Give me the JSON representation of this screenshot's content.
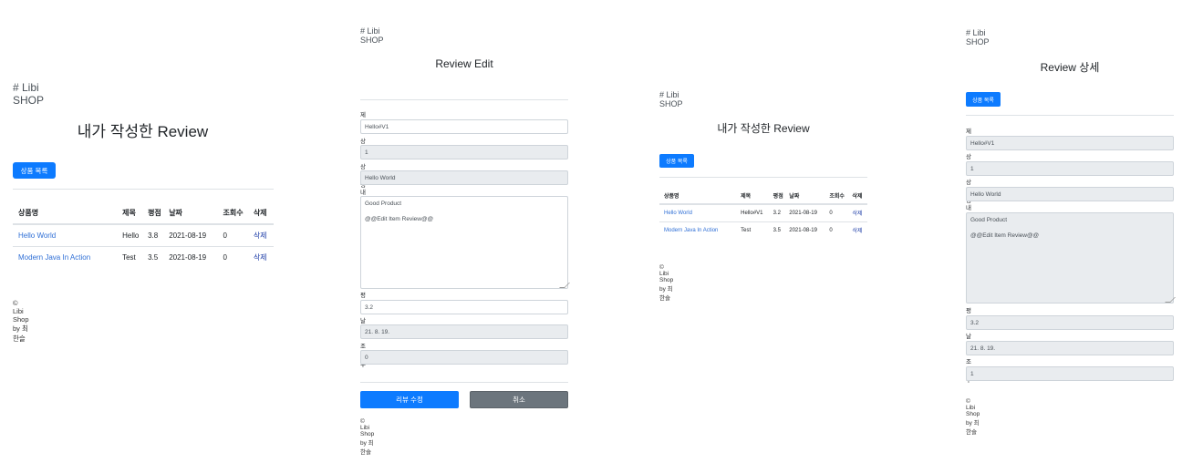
{
  "brand": "# Libi SHOP",
  "footer": "© Libi Shop by 최한슬",
  "my_reviews": {
    "title": "내가 작성한 Review",
    "list_button": "상품 목록",
    "columns": [
      "상품명",
      "제목",
      "평점",
      "날짜",
      "조회수",
      "삭제"
    ],
    "rows_v1": [
      {
        "product": "Hello World",
        "title": "Hello",
        "rating": "3.8",
        "date": "2021-08-19",
        "views": "0",
        "delete": "삭제"
      },
      {
        "product": "Modern Java In Action",
        "title": "Test",
        "rating": "3.5",
        "date": "2021-08-19",
        "views": "0",
        "delete": "삭제"
      }
    ],
    "rows_v2": [
      {
        "product": "Hello World",
        "title": "Hello#V1",
        "rating": "3.2",
        "date": "2021-08-19",
        "views": "0",
        "delete": "삭제"
      },
      {
        "product": "Modern Java In Action",
        "title": "Test",
        "rating": "3.5",
        "date": "2021-08-19",
        "views": "0",
        "delete": "삭제"
      }
    ]
  },
  "edit": {
    "title": "Review Edit",
    "labels": {
      "title": "제목",
      "product_id": "상품 ID",
      "product_name": "상품명",
      "content": "내용",
      "rating": "평점",
      "date": "날짜",
      "views": "조회수"
    },
    "values": {
      "title": "Hello#V1",
      "product_id": "1",
      "product_name": "Hello World",
      "content": "Good Product\n\n@@Edit Item Review@@",
      "rating": "3.2",
      "date": "21. 8. 19.",
      "views": "0"
    },
    "submit_button": "리뷰 수정",
    "cancel_button": "취소"
  },
  "detail": {
    "title": "Review 상세",
    "list_button": "상품 목록",
    "labels": {
      "title": "제목",
      "product_id": "상품 ID",
      "product_name": "상품명",
      "content": "내용",
      "rating": "평점",
      "date": "날짜",
      "views": "조회수"
    },
    "values": {
      "title": "Hello#V1",
      "product_id": "1",
      "product_name": "Hello World",
      "content": "Good Product\n\n@@Edit Item Review@@",
      "rating": "3.2",
      "date": "21. 8. 19.",
      "views": "1"
    }
  },
  "colors": {
    "primary": "#0d7bff",
    "secondary": "#6c757d",
    "link": "#2f6fd6"
  }
}
